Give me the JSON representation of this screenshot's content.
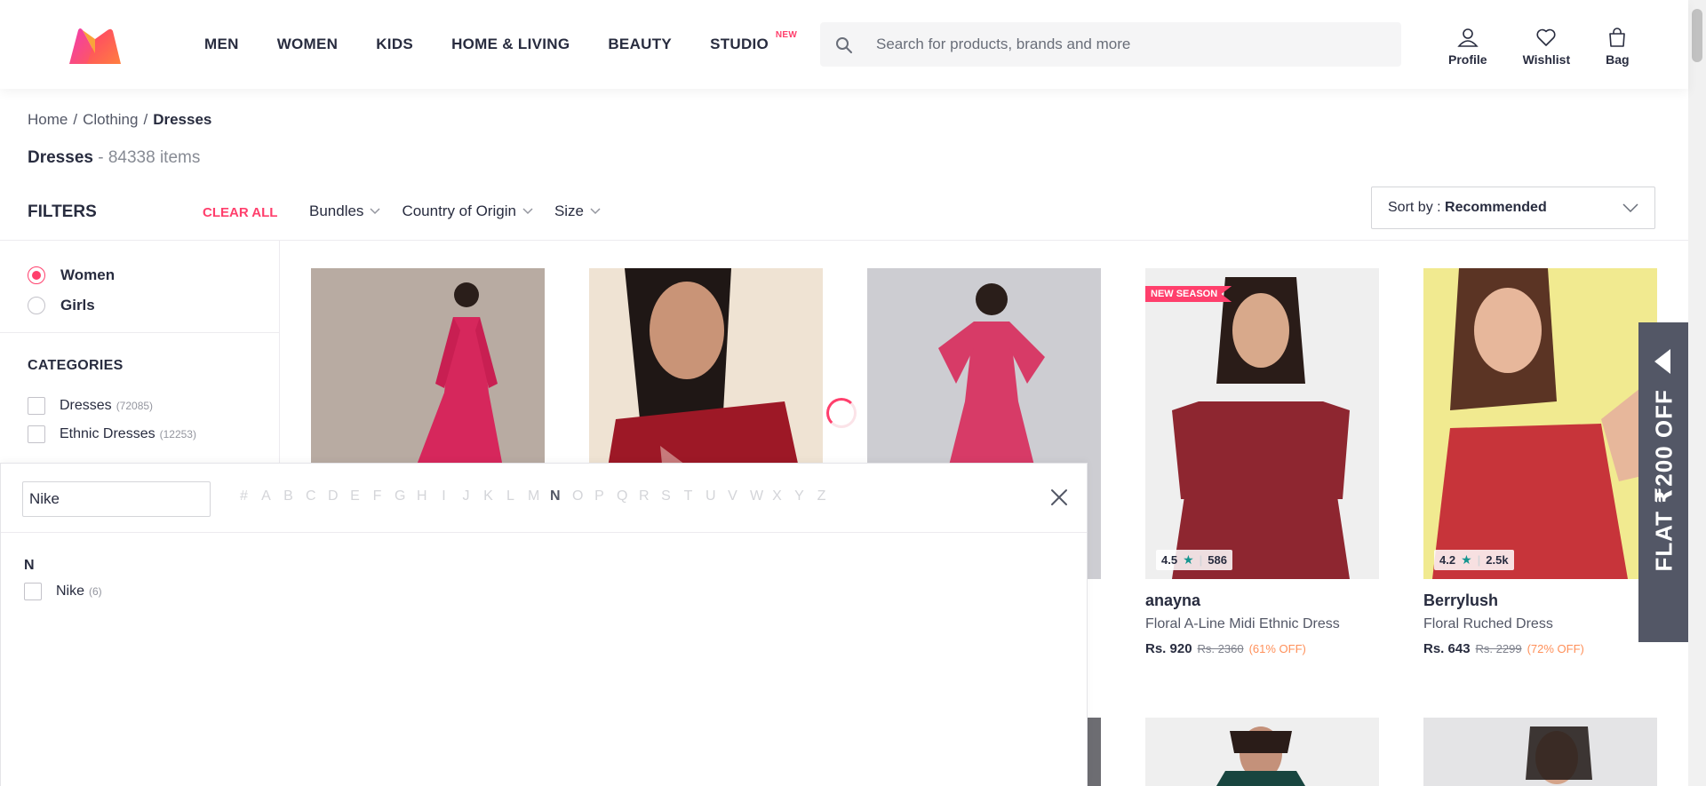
{
  "nav": {
    "items": [
      {
        "label": "MEN"
      },
      {
        "label": "WOMEN"
      },
      {
        "label": "KIDS"
      },
      {
        "label": "HOME & LIVING"
      },
      {
        "label": "BEAUTY"
      },
      {
        "label": "STUDIO",
        "badge": "NEW"
      }
    ]
  },
  "search": {
    "placeholder": "Search for products, brands and more"
  },
  "actions": {
    "profile": "Profile",
    "wishlist": "Wishlist",
    "bag": "Bag"
  },
  "breadcrumb": {
    "home": "Home",
    "clothing": "Clothing",
    "current": "Dresses"
  },
  "title": {
    "name": "Dresses",
    "count": "- 84338 items"
  },
  "filterbar": {
    "label": "FILTERS",
    "clear": "CLEAR ALL",
    "filters": [
      "Bundles",
      "Country of Origin",
      "Size"
    ],
    "sort_prefix": "Sort by : ",
    "sort_value": "Recommended"
  },
  "sidebar": {
    "gender": [
      {
        "label": "Women",
        "selected": true
      },
      {
        "label": "Girls",
        "selected": false
      }
    ],
    "categories_title": "CATEGORIES",
    "categories": [
      {
        "label": "Dresses",
        "count": "(72085)"
      },
      {
        "label": "Ethnic Dresses",
        "count": "(12253)"
      }
    ]
  },
  "products": [
    {
      "badge": "NEW SEASON",
      "rating": "4.5",
      "reviews": "586",
      "brand": "anayna",
      "desc": "Floral A-Line Midi Ethnic Dress",
      "price": "Rs. 920",
      "mrp": "Rs. 2360",
      "off": "(61% OFF)"
    },
    {
      "rating": "4.2",
      "reviews": "2.5k",
      "brand": "Berrylush",
      "desc": "Floral Ruched Dress",
      "price": "Rs. 643",
      "mrp": "Rs. 2299",
      "off": "(72% OFF)"
    }
  ],
  "promo": {
    "text": "FLAT ₹200 OFF"
  },
  "brand_overlay": {
    "input_value": "Nike",
    "alphabet": [
      "#",
      "A",
      "B",
      "C",
      "D",
      "E",
      "F",
      "G",
      "H",
      "I",
      "J",
      "K",
      "L",
      "M",
      "N",
      "O",
      "P",
      "Q",
      "R",
      "S",
      "T",
      "U",
      "V",
      "W",
      "X",
      "Y",
      "Z"
    ],
    "active_letter": "N",
    "group_letter": "N",
    "items": [
      {
        "label": "Nike",
        "count": "(6)"
      }
    ]
  },
  "colors": {
    "accent": "#ff3f6c",
    "rating_star": "#14958f",
    "discount": "#ff905a",
    "promo_bg": "#535766"
  }
}
